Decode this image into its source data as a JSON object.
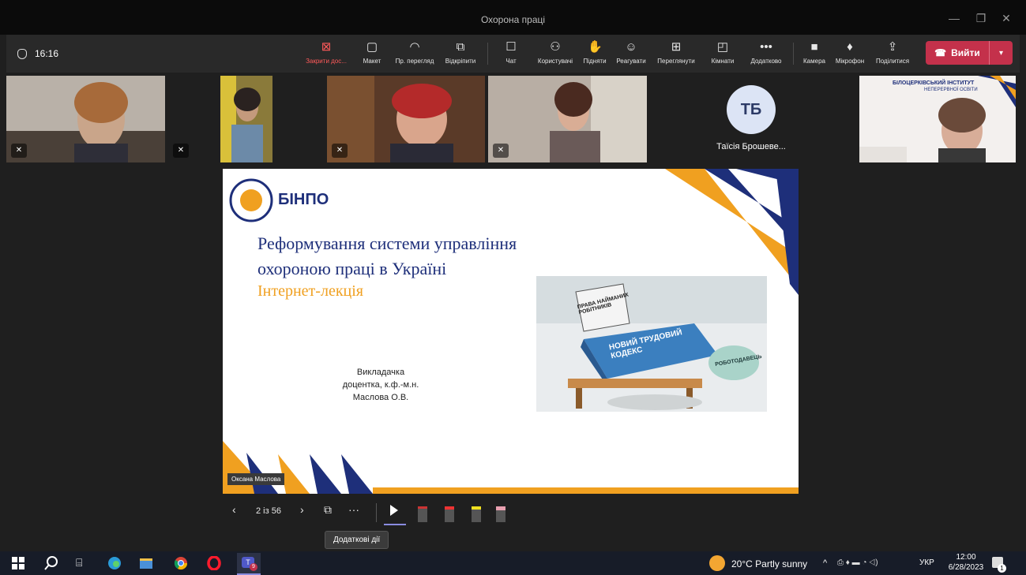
{
  "window": {
    "title": "Охорона праці"
  },
  "toolbar": {
    "timer": "16:16",
    "buttons": {
      "stop_share": "Закрити дос...",
      "layout": "Макет",
      "view": "Пр. перегляд",
      "popout": "Відкріпити",
      "chat": "Чат",
      "people": "Користувачі",
      "raise": "Підняти",
      "react": "Реагувати",
      "views": "Переглянути",
      "rooms": "Кімнати",
      "more": "Додатково",
      "camera": "Камера",
      "mic": "Мікрофон",
      "share": "Поділитися"
    },
    "leave": "Вийти"
  },
  "participants": {
    "avatar_initials": "ТБ",
    "avatar_name": "Таїсія Брошеве..."
  },
  "slide": {
    "logo": "БІНПО",
    "title_line1": "Реформування системи управління",
    "title_line2": "охороною праці в Україні",
    "subtitle": "Інтернет-лекція",
    "lecturer_role": "Викладачка",
    "lecturer_degree": "доцентка, к.ф.-м.н.",
    "lecturer_name": "Маслова О.В.",
    "name_tag": "Оксана Маслова",
    "banner_title": "БІЛОЦЕРКІВСЬКИЙ ІНСТИТУТ",
    "banner_sub": "НЕПЕРЕРВНОЇ ОСВІТИ",
    "cartoon_book": "НОВИЙ ТРУДОВИЙ КОДЕКС",
    "cartoon_paper": "ПРАВА НАЙМАНИХ РОБІТНИКІВ",
    "cartoon_sack": "РОБОТОДАВЕЦЬ"
  },
  "presenter": {
    "page_count": "2 із 56",
    "tooltip": "Додаткові дії"
  },
  "taskbar": {
    "weather": "20°C  Partly sunny",
    "lang": "УКР",
    "time": "12:00",
    "date": "6/28/2023",
    "teams_badge": "9",
    "notif_badge": "1"
  },
  "colors": {
    "accent_navy": "#1e2f7a",
    "accent_orange": "#f0a020",
    "leave_red": "#c4314b"
  }
}
